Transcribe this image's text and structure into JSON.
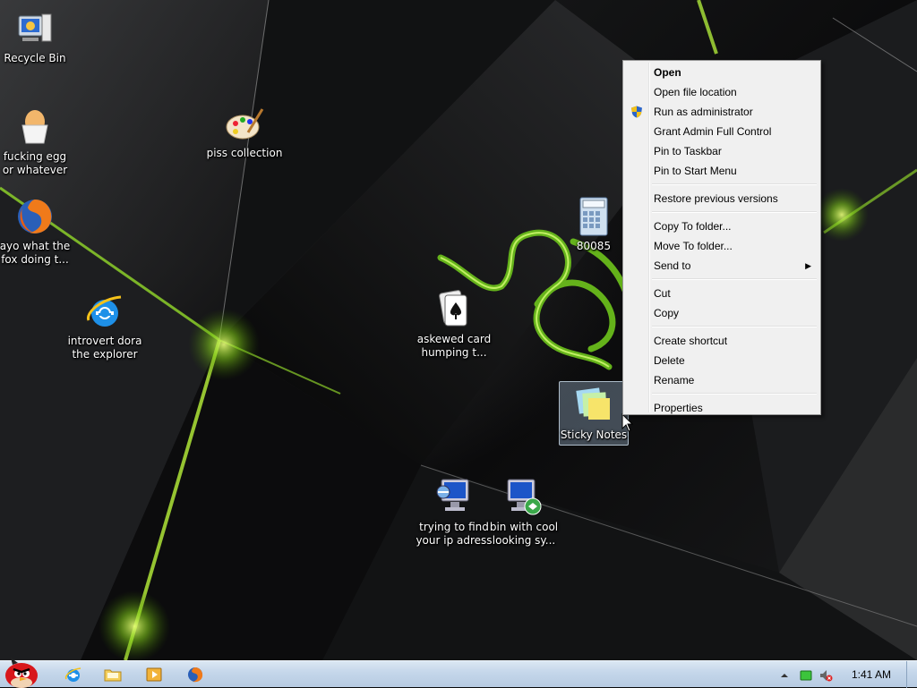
{
  "desktop_icons": [
    {
      "id": "recycle-bin",
      "label": "Recycle Bin",
      "icon": "recycle-bin-icon"
    },
    {
      "id": "egg",
      "label": "fucking egg or whatever",
      "icon": "egg-icon"
    },
    {
      "id": "firefox",
      "label": "ayo what the fox doing t...",
      "icon": "firefox-icon"
    },
    {
      "id": "ie",
      "label": "introvert dora the explorer",
      "icon": "internet-explorer-icon"
    },
    {
      "id": "paint",
      "label": "piss collection",
      "icon": "paint-palette-icon"
    },
    {
      "id": "calculator",
      "label": "80085",
      "icon": "calculator-icon"
    },
    {
      "id": "solitaire",
      "label": "askewed card humping t...",
      "icon": "playing-cards-icon"
    },
    {
      "id": "sticky-notes",
      "label": "Sticky Notes",
      "icon": "sticky-notes-icon",
      "selected": true
    },
    {
      "id": "ip",
      "label": "trying to find your ip adress",
      "icon": "network-computer-icon"
    },
    {
      "id": "remote",
      "label": "bin with cool looking sy...",
      "icon": "remote-desktop-icon"
    }
  ],
  "context_menu": {
    "groups": [
      [
        {
          "label": "Open",
          "bold": true
        },
        {
          "label": "Open file location"
        },
        {
          "label": "Run as administrator",
          "icon": "uac-shield-icon"
        },
        {
          "label": "Grant Admin Full Control"
        },
        {
          "label": "Pin to Taskbar"
        },
        {
          "label": "Pin to Start Menu"
        }
      ],
      [
        {
          "label": "Restore previous versions"
        }
      ],
      [
        {
          "label": "Copy To folder..."
        },
        {
          "label": "Move To folder..."
        },
        {
          "label": "Send to",
          "submenu": true
        }
      ],
      [
        {
          "label": "Cut"
        },
        {
          "label": "Copy"
        }
      ],
      [
        {
          "label": "Create shortcut"
        },
        {
          "label": "Delete"
        },
        {
          "label": "Rename"
        }
      ],
      [
        {
          "label": "Properties"
        }
      ]
    ]
  },
  "taskbar": {
    "start_icon": "angry-bird-start-icon",
    "pinned": [
      "internet-explorer-icon",
      "folder-icon",
      "media-player-icon",
      "firefox-icon"
    ],
    "tray": [
      "show-hidden-icons-arrow",
      "network-icon",
      "volume-muted-icon"
    ],
    "clock": "1:41 AM"
  },
  "colors": {
    "accent_green": "#7ccf1e",
    "taskbar_top": "#dbe7f3",
    "menu_bg": "#f0f0f0"
  }
}
